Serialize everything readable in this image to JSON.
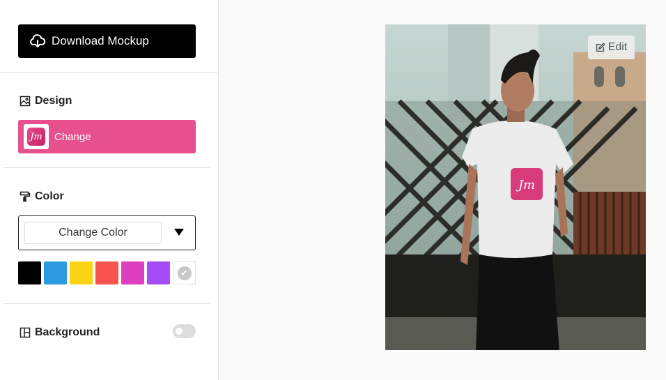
{
  "sidebar": {
    "download_label": "Download Mockup",
    "design": {
      "title": "Design",
      "change_label": "Change"
    },
    "color": {
      "title": "Color",
      "input_value": "Change Color",
      "swatches": [
        "#000000",
        "#2b9ae0",
        "#fad415",
        "#f8544f",
        "#de3fbf",
        "#a54cf7",
        "#ffffff"
      ],
      "selected": "#ffffff"
    },
    "background": {
      "title": "Background",
      "enabled": false
    }
  },
  "preview": {
    "edit_label": "Edit",
    "shirt_color": "#ffffff",
    "logo_text": "Jm"
  },
  "colors": {
    "accent": "#e5508d"
  }
}
